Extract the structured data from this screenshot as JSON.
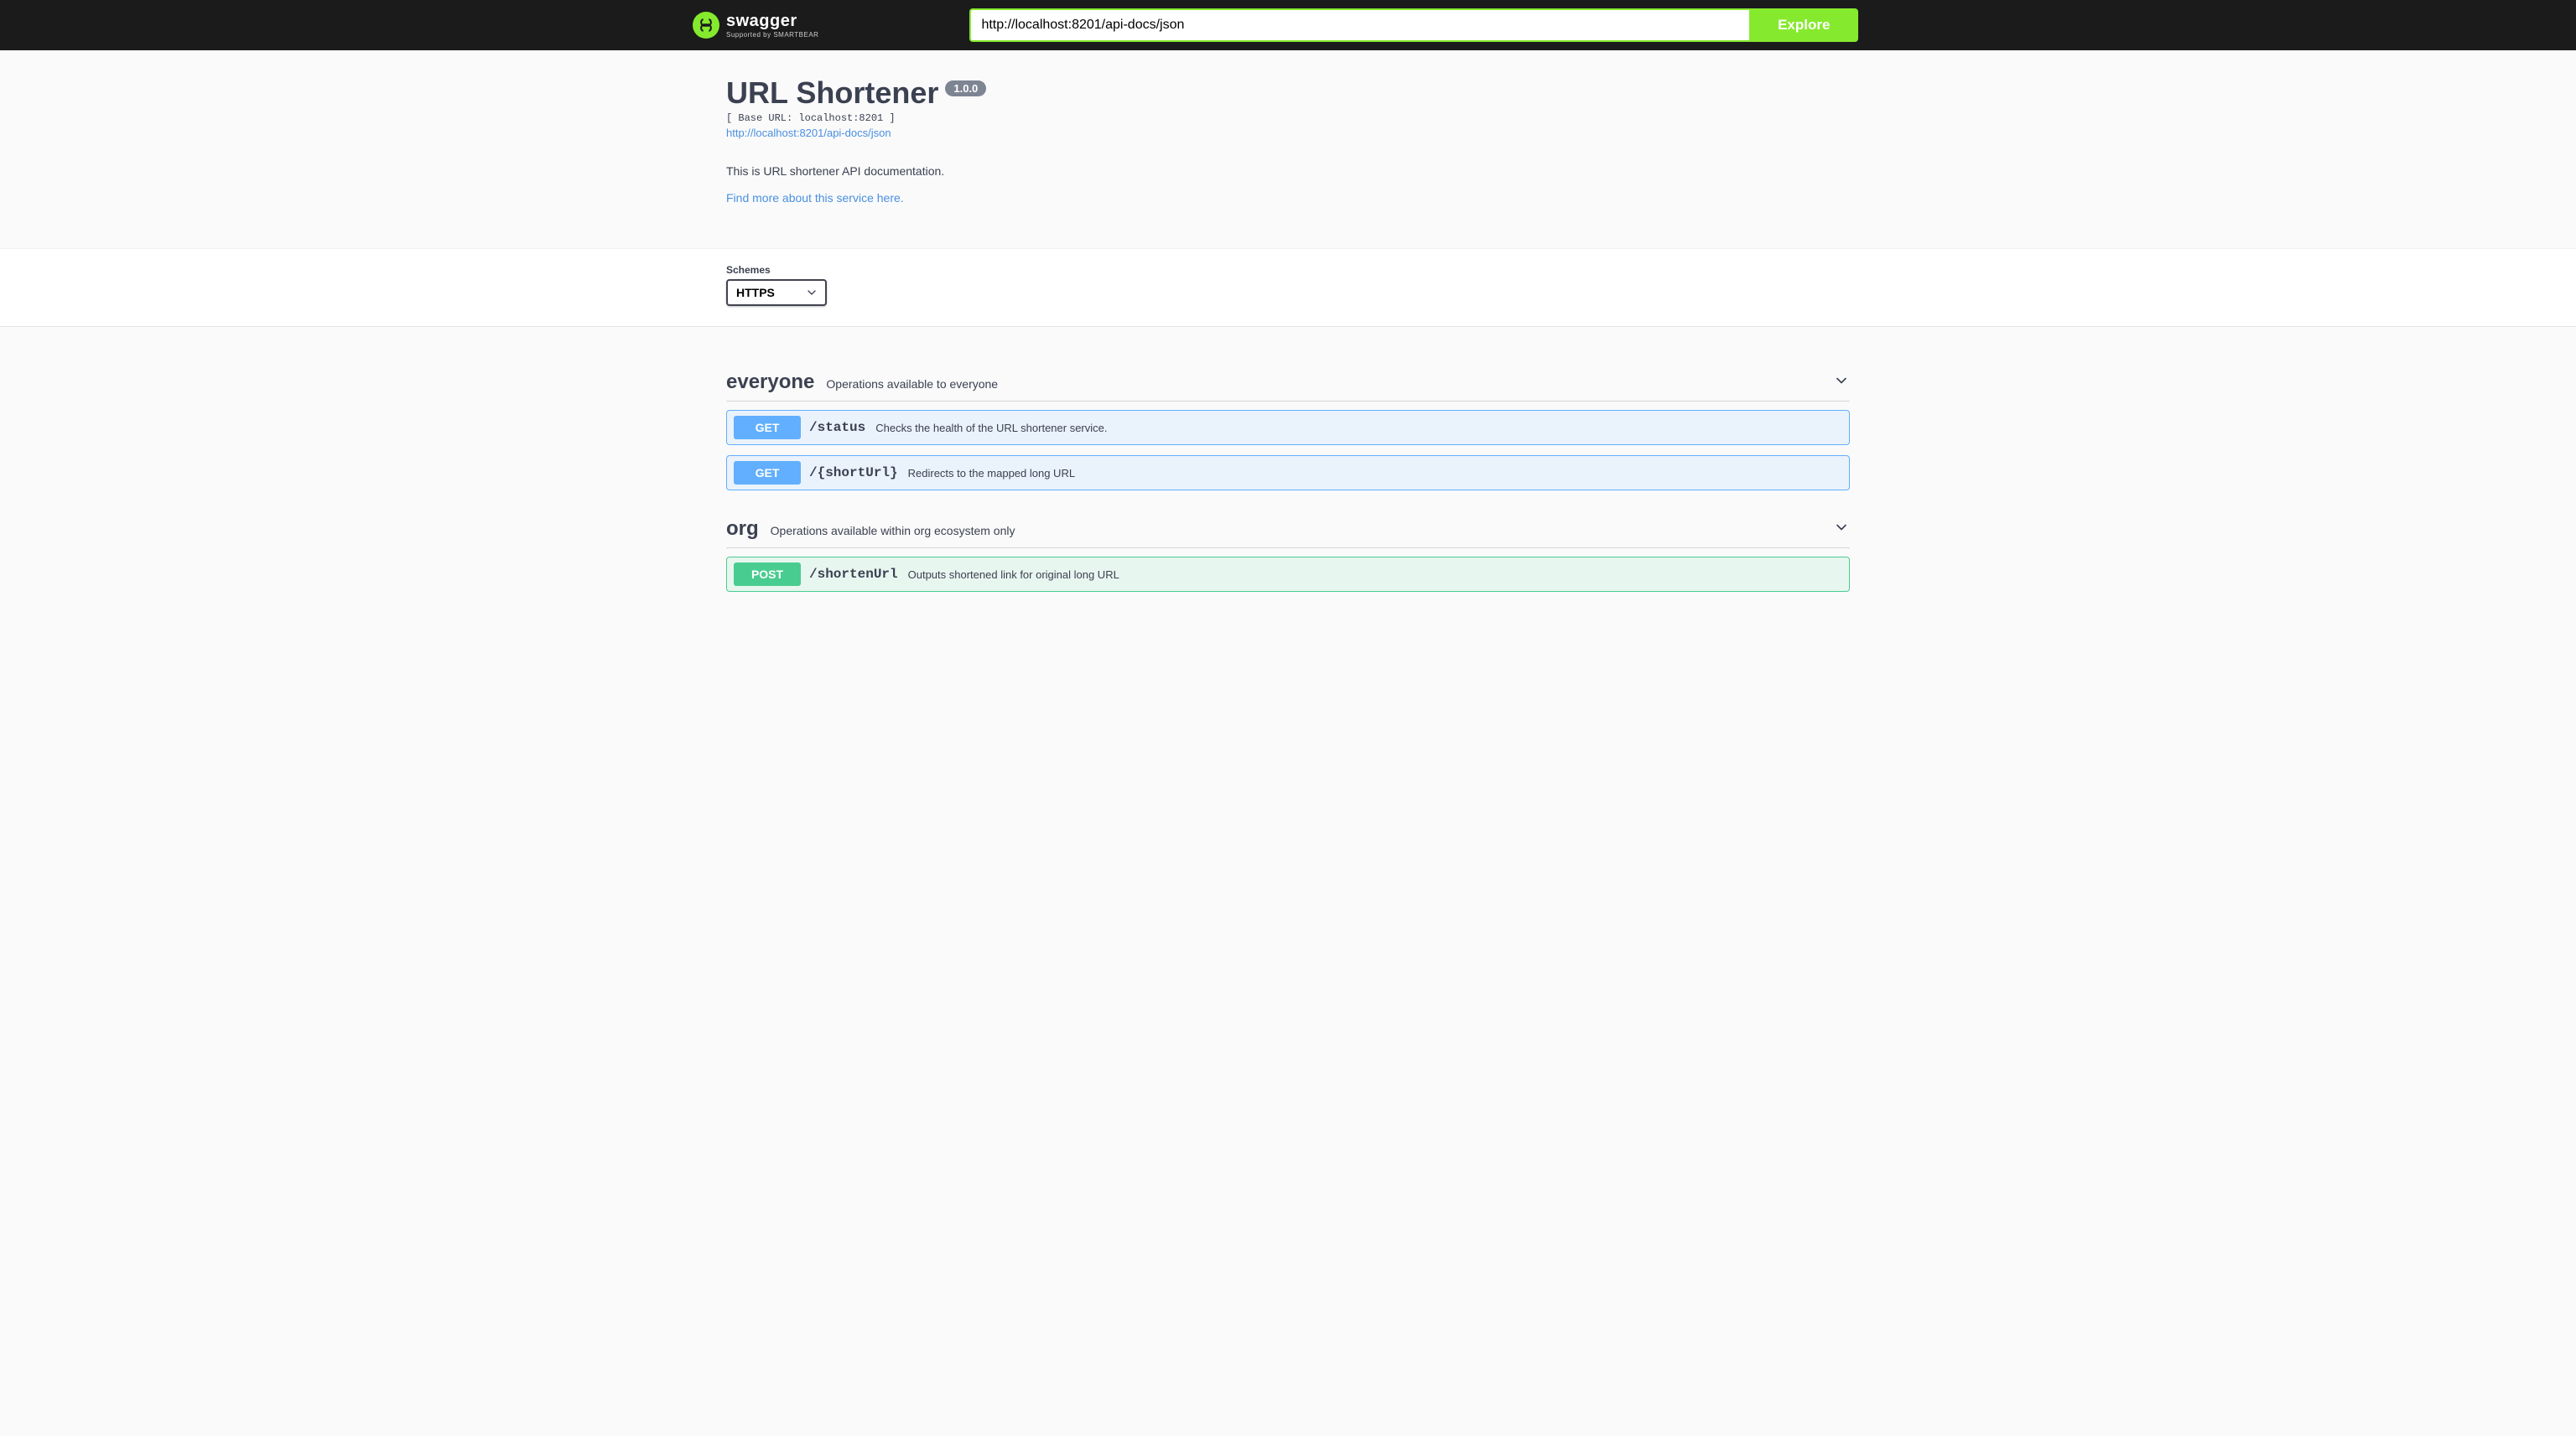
{
  "topbar": {
    "logo_title": "swagger",
    "logo_sub": "Supported by SMARTBEAR",
    "input_value": "http://localhost:8201/api-docs/json",
    "explore_label": "Explore"
  },
  "info": {
    "title": "URL Shortener",
    "version": "1.0.0",
    "base_url_text": "[ Base URL: localhost:8201 ]",
    "docs_url": "http://localhost:8201/api-docs/json",
    "description": "This is URL shortener API documentation.",
    "external_link_text": "Find more about this service here."
  },
  "schemes": {
    "label": "Schemes",
    "selected": "HTTPS"
  },
  "tags": [
    {
      "name": "everyone",
      "description": "Operations available to everyone",
      "operations": [
        {
          "method": "GET",
          "method_class": "get",
          "path": "/status",
          "summary": "Checks the health of the URL shortener service."
        },
        {
          "method": "GET",
          "method_class": "get",
          "path": "/{shortUrl}",
          "summary": "Redirects to the mapped long URL"
        }
      ]
    },
    {
      "name": "org",
      "description": "Operations available within org ecosystem only",
      "operations": [
        {
          "method": "POST",
          "method_class": "post",
          "path": "/shortenUrl",
          "summary": "Outputs shortened link for original long URL"
        }
      ]
    }
  ]
}
